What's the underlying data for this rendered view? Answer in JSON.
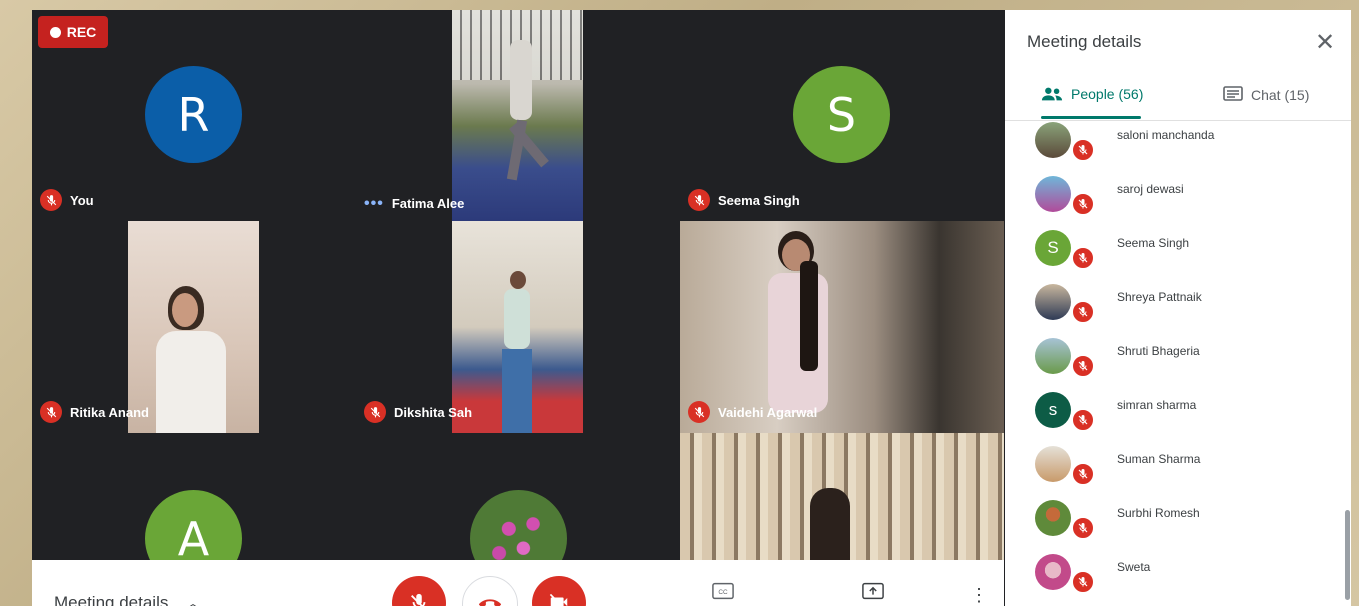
{
  "recording": {
    "label": "REC"
  },
  "tiles": [
    {
      "name": "You",
      "avatar_letter": "R",
      "avatar_color": "#0b5ea8"
    },
    {
      "name": "Fatima Alee"
    },
    {
      "name": "Seema Singh",
      "avatar_letter": "S",
      "avatar_color": "#6aa637"
    },
    {
      "name": "Ritika Anand"
    },
    {
      "name": "Dikshita Sah"
    },
    {
      "name": "Vaidehi Agarwal"
    },
    {
      "avatar_letter": "A",
      "avatar_color": "#6aa637"
    },
    {},
    {}
  ],
  "bottom_bar": {
    "meeting_details_label": "Meeting details",
    "chevron_icon": "chevron-up-icon",
    "mic_color": "#d93025",
    "camera_color": "#d93025",
    "end_call_color": "#d93025"
  },
  "panel": {
    "title": "Meeting details",
    "close_icon": "close-icon",
    "tabs": [
      {
        "label": "People (56)",
        "icon": "people-icon"
      },
      {
        "label": "Chat (15)",
        "icon": "chat-icon"
      }
    ],
    "accent_color": "#00796b",
    "people": [
      {
        "name": "saloni manchanda"
      },
      {
        "name": "saroj dewasi"
      },
      {
        "name": "Seema Singh",
        "avatar_letter": "S",
        "avatar_color": "#6aa637"
      },
      {
        "name": "Shreya Pattnaik"
      },
      {
        "name": "Shruti Bhageria"
      },
      {
        "name": "simran sharma",
        "avatar_letter": "s",
        "avatar_color": "#0d5c46"
      },
      {
        "name": "Suman Sharma"
      },
      {
        "name": "Surbhi Romesh"
      },
      {
        "name": "Sweta"
      }
    ]
  }
}
